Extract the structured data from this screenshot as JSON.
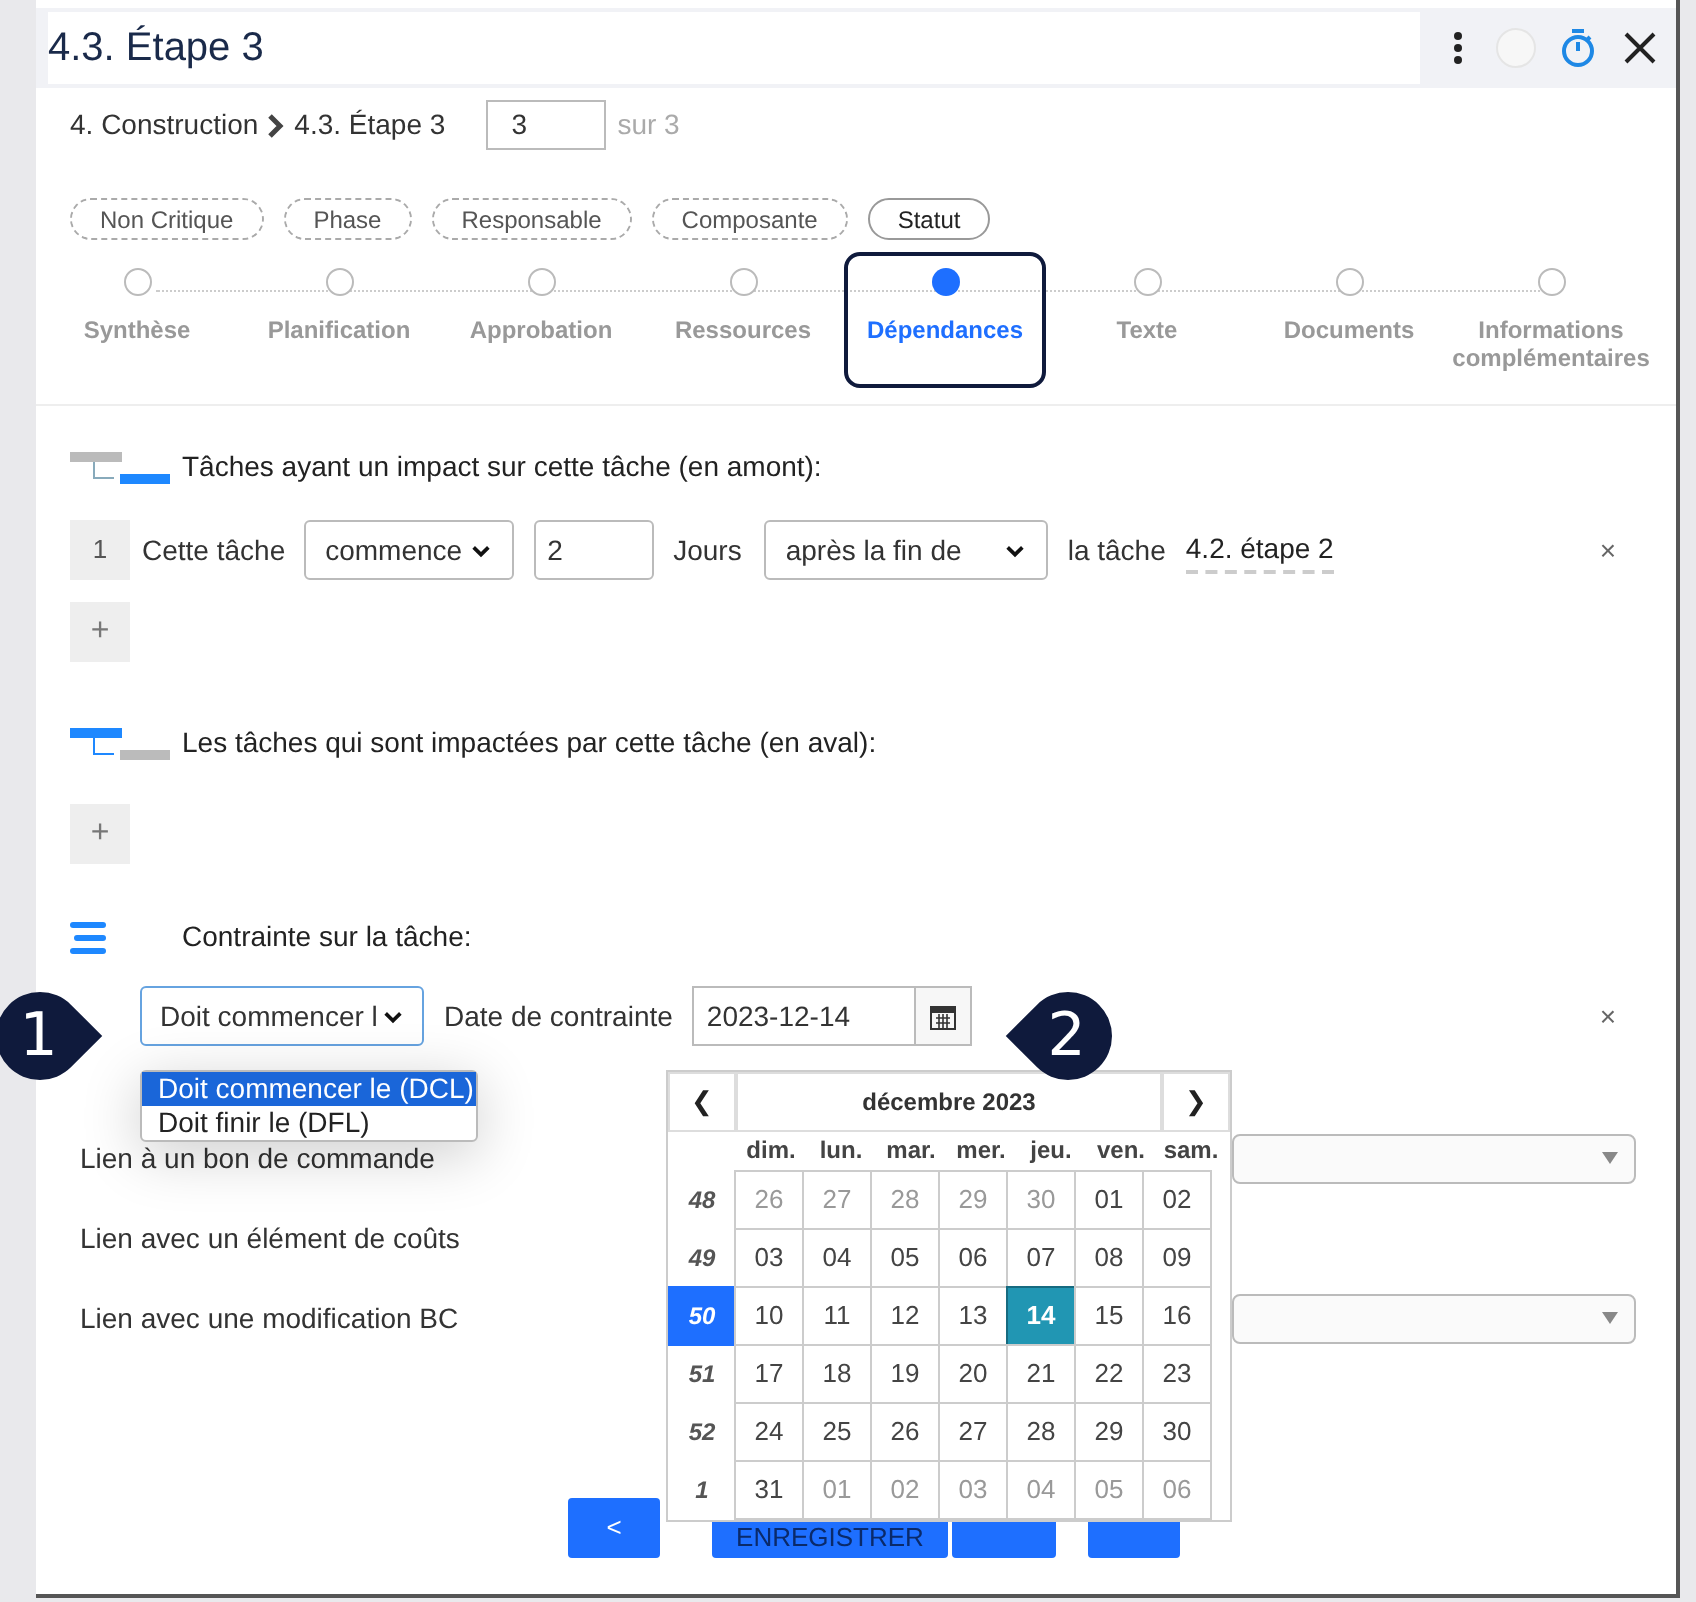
{
  "header": {
    "title": "4.3. Étape 3"
  },
  "breadcrumb": {
    "items": [
      "4. Construction",
      "4.3. Étape 3"
    ],
    "page_value": "3",
    "page_total": "sur 3"
  },
  "tags": [
    {
      "label": "Non Critique",
      "active": false
    },
    {
      "label": "Phase",
      "active": false
    },
    {
      "label": "Responsable",
      "active": false
    },
    {
      "label": "Composante",
      "active": false
    },
    {
      "label": "Statut",
      "active": true
    }
  ],
  "steps": [
    {
      "label": "Synthèse",
      "selected": false
    },
    {
      "label": "Planification",
      "selected": false
    },
    {
      "label": "Approbation",
      "selected": false
    },
    {
      "label": "Ressources",
      "selected": false
    },
    {
      "label": "Dépendances",
      "selected": true
    },
    {
      "label": "Texte",
      "selected": false
    },
    {
      "label": "Documents",
      "selected": false
    },
    {
      "label": "Informations complémentaires",
      "selected": false
    }
  ],
  "upstream": {
    "title": "Tâches ayant un impact sur cette tâche (en amont):",
    "add": "+",
    "rows": [
      {
        "index": "1",
        "prefix": "Cette tâche",
        "verb": "commence",
        "amount": "2",
        "unit": "Jours",
        "relation": "après la fin de",
        "task_label": "la tâche",
        "task": "4.2. étape 2",
        "remove": "×"
      }
    ]
  },
  "downstream": {
    "title": "Les tâches qui sont impactées par cette tâche (en aval):",
    "add": "+"
  },
  "constraint": {
    "title": "Contrainte sur la tâche:",
    "type_value": "Doit commencer l",
    "date_label": "Date de contrainte",
    "date_value": "2023-12-14",
    "remove": "×",
    "options": [
      {
        "label": "Doit commencer le (DCL)",
        "selected": true
      },
      {
        "label": "Doit finir le (DFL)",
        "selected": false
      }
    ]
  },
  "links": [
    "Lien à un bon de commande",
    "Lien avec un élément de coûts",
    "Lien avec une modification BC"
  ],
  "footer": {
    "prev": "<",
    "save": "ENREGISTRER"
  },
  "callouts": [
    "1",
    "2"
  ],
  "calendar": {
    "prev": "❮",
    "next": "❯",
    "month": "décembre 2023",
    "weekdays": [
      "dim.",
      "lun.",
      "mar.",
      "mer.",
      "jeu.",
      "ven.",
      "sam."
    ],
    "weeks": [
      {
        "number": "48",
        "selected": false,
        "days": [
          {
            "label": "26",
            "muted": true,
            "selected": false
          },
          {
            "label": "27",
            "muted": true,
            "selected": false
          },
          {
            "label": "28",
            "muted": true,
            "selected": false
          },
          {
            "label": "29",
            "muted": true,
            "selected": false
          },
          {
            "label": "30",
            "muted": true,
            "selected": false
          },
          {
            "label": "01",
            "muted": false,
            "selected": false
          },
          {
            "label": "02",
            "muted": false,
            "selected": false
          }
        ]
      },
      {
        "number": "49",
        "selected": false,
        "days": [
          {
            "label": "03",
            "muted": false,
            "selected": false
          },
          {
            "label": "04",
            "muted": false,
            "selected": false
          },
          {
            "label": "05",
            "muted": false,
            "selected": false
          },
          {
            "label": "06",
            "muted": false,
            "selected": false
          },
          {
            "label": "07",
            "muted": false,
            "selected": false
          },
          {
            "label": "08",
            "muted": false,
            "selected": false
          },
          {
            "label": "09",
            "muted": false,
            "selected": false
          }
        ]
      },
      {
        "number": "50",
        "selected": true,
        "days": [
          {
            "label": "10",
            "muted": false,
            "selected": false
          },
          {
            "label": "11",
            "muted": false,
            "selected": false
          },
          {
            "label": "12",
            "muted": false,
            "selected": false
          },
          {
            "label": "13",
            "muted": false,
            "selected": false
          },
          {
            "label": "14",
            "muted": false,
            "selected": true
          },
          {
            "label": "15",
            "muted": false,
            "selected": false
          },
          {
            "label": "16",
            "muted": false,
            "selected": false
          }
        ]
      },
      {
        "number": "51",
        "selected": false,
        "days": [
          {
            "label": "17",
            "muted": false,
            "selected": false
          },
          {
            "label": "18",
            "muted": false,
            "selected": false
          },
          {
            "label": "19",
            "muted": false,
            "selected": false
          },
          {
            "label": "20",
            "muted": false,
            "selected": false
          },
          {
            "label": "21",
            "muted": false,
            "selected": false
          },
          {
            "label": "22",
            "muted": false,
            "selected": false
          },
          {
            "label": "23",
            "muted": false,
            "selected": false
          }
        ]
      },
      {
        "number": "52",
        "selected": false,
        "days": [
          {
            "label": "24",
            "muted": false,
            "selected": false
          },
          {
            "label": "25",
            "muted": false,
            "selected": false
          },
          {
            "label": "26",
            "muted": false,
            "selected": false
          },
          {
            "label": "27",
            "muted": false,
            "selected": false
          },
          {
            "label": "28",
            "muted": false,
            "selected": false
          },
          {
            "label": "29",
            "muted": false,
            "selected": false
          },
          {
            "label": "30",
            "muted": false,
            "selected": false
          }
        ]
      },
      {
        "number": "1",
        "selected": false,
        "days": [
          {
            "label": "31",
            "muted": false,
            "selected": false
          },
          {
            "label": "01",
            "muted": true,
            "selected": false
          },
          {
            "label": "02",
            "muted": true,
            "selected": false
          },
          {
            "label": "03",
            "muted": true,
            "selected": false
          },
          {
            "label": "04",
            "muted": true,
            "selected": false
          },
          {
            "label": "05",
            "muted": true,
            "selected": false
          },
          {
            "label": "06",
            "muted": true,
            "selected": false
          }
        ]
      }
    ]
  }
}
